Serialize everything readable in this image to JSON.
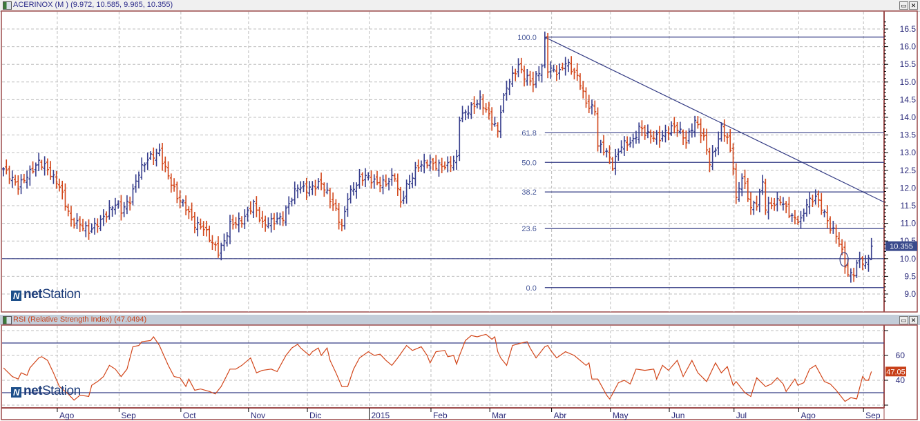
{
  "window": {
    "title": "ACERINOX (M ) (9.972, 10.585, 9.965, 10.355)",
    "maximize_icon": "maximize-icon",
    "close_icon": "close-icon",
    "maximize_glyph": "▭",
    "close_glyph": "✕"
  },
  "rsi_panel": {
    "title": "RSI (Relative Strength Index) (47.0494)"
  },
  "logo": {
    "mark": "N",
    "net": "net",
    "station": "Station"
  },
  "colors": {
    "up": "#363d8c",
    "down": "#d2461a",
    "line": "#343c84",
    "rsi": "#d2461a",
    "axis_text": "#2a2a7a",
    "border": "#9c4a4a",
    "grid": "#bdbdbd"
  },
  "time_axis": {
    "labels": [
      "Ago",
      "Sep",
      "Oct",
      "Nov",
      "Dic",
      "2015",
      "Feb",
      "Mar",
      "Abr",
      "May",
      "Jun",
      "Jul",
      "Ago",
      "Sep"
    ],
    "label_bar_index": [
      19,
      40,
      61,
      84,
      104,
      125,
      146,
      166,
      187,
      207,
      227,
      249,
      271,
      293
    ]
  },
  "chart_data": [
    {
      "type": "ohlc",
      "title": "ACERINOX (M )",
      "last_bar": {
        "open": 9.972,
        "high": 10.585,
        "low": 9.965,
        "close": 10.355
      },
      "last_price_label": "10.355",
      "ylim": [
        8.7,
        16.8
      ],
      "yticks": [
        "16.5",
        "16.0",
        "15.5",
        "15.0",
        "14.5",
        "14.0",
        "13.5",
        "13.0",
        "12.5",
        "12.0",
        "11.5",
        "11.0",
        "10.5",
        "10.0",
        "9.5",
        "9.0"
      ],
      "bar_count": 296,
      "close_path": [
        [
          0,
          12.54
        ],
        [
          5,
          12.05
        ],
        [
          12,
          12.73
        ],
        [
          14,
          12.63
        ],
        [
          19,
          12.05
        ],
        [
          23,
          11.07
        ],
        [
          26,
          10.97
        ],
        [
          29,
          10.78
        ],
        [
          33,
          11.07
        ],
        [
          38,
          11.56
        ],
        [
          40,
          11.36
        ],
        [
          43,
          11.66
        ],
        [
          46,
          12.44
        ],
        [
          49,
          12.83
        ],
        [
          53,
          13.02
        ],
        [
          55,
          12.54
        ],
        [
          59,
          11.75
        ],
        [
          62,
          11.46
        ],
        [
          65,
          10.97
        ],
        [
          68,
          10.88
        ],
        [
          70,
          10.58
        ],
        [
          73,
          10.19
        ],
        [
          75,
          10.48
        ],
        [
          77,
          10.97
        ],
        [
          81,
          11.07
        ],
        [
          85,
          11.56
        ],
        [
          88,
          10.97
        ],
        [
          92,
          11.07
        ],
        [
          95,
          11.17
        ],
        [
          97,
          11.56
        ],
        [
          100,
          12.05
        ],
        [
          103,
          11.95
        ],
        [
          108,
          12.14
        ],
        [
          110,
          11.85
        ],
        [
          113,
          11.36
        ],
        [
          115,
          10.88
        ],
        [
          117,
          11.75
        ],
        [
          121,
          12.24
        ],
        [
          123,
          12.34
        ],
        [
          127,
          12.14
        ],
        [
          130,
          12.14
        ],
        [
          133,
          12.34
        ],
        [
          135,
          11.56
        ],
        [
          137,
          12.05
        ],
        [
          141,
          12.63
        ],
        [
          144,
          12.73
        ],
        [
          147,
          12.63
        ],
        [
          151,
          12.63
        ],
        [
          154,
          12.83
        ],
        [
          155,
          14.0
        ],
        [
          158,
          14.2
        ],
        [
          162,
          14.49
        ],
        [
          164,
          14.2
        ],
        [
          168,
          13.61
        ],
        [
          169,
          14.2
        ],
        [
          171,
          14.88
        ],
        [
          175,
          15.46
        ],
        [
          177,
          15.17
        ],
        [
          180,
          14.98
        ],
        [
          183,
          15.46
        ],
        [
          184,
          16.15
        ],
        [
          185,
          15.37
        ],
        [
          189,
          15.27
        ],
        [
          191,
          15.56
        ],
        [
          194,
          15.27
        ],
        [
          196,
          14.98
        ],
        [
          198,
          14.39
        ],
        [
          201,
          14.2
        ],
        [
          202,
          13.22
        ],
        [
          205,
          13.02
        ],
        [
          207,
          12.63
        ],
        [
          210,
          13.22
        ],
        [
          214,
          13.32
        ],
        [
          216,
          13.71
        ],
        [
          219,
          13.51
        ],
        [
          223,
          13.41
        ],
        [
          227,
          13.71
        ],
        [
          229,
          13.71
        ],
        [
          232,
          13.32
        ],
        [
          235,
          13.9
        ],
        [
          238,
          13.41
        ],
        [
          240,
          12.73
        ],
        [
          242,
          13.12
        ],
        [
          244,
          13.71
        ],
        [
          246,
          13.41
        ],
        [
          248,
          12.63
        ],
        [
          249,
          11.66
        ],
        [
          251,
          12.34
        ],
        [
          254,
          11.46
        ],
        [
          256,
          11.56
        ],
        [
          258,
          12.14
        ],
        [
          259,
          11.46
        ],
        [
          262,
          11.56
        ],
        [
          264,
          11.66
        ],
        [
          268,
          11.17
        ],
        [
          271,
          11.07
        ],
        [
          273,
          11.56
        ],
        [
          276,
          11.75
        ],
        [
          278,
          11.46
        ],
        [
          281,
          10.88
        ],
        [
          283,
          10.68
        ],
        [
          285,
          10.19
        ],
        [
          287,
          9.51
        ],
        [
          289,
          9.61
        ],
        [
          291,
          10.0
        ],
        [
          293,
          9.8
        ],
        [
          295,
          10.355
        ]
      ],
      "support_line": 10.0,
      "fibonacci": {
        "start_bar": 184,
        "high": 16.27,
        "low": 9.18,
        "levels": [
          {
            "pct": 100.0,
            "label": "100.0"
          },
          {
            "pct": 61.8,
            "label": "61.8"
          },
          {
            "pct": 50.0,
            "label": "50.0"
          },
          {
            "pct": 38.2,
            "label": "38.2"
          },
          {
            "pct": 23.6,
            "label": "23.6"
          },
          {
            "pct": 0.0,
            "label": "0.0"
          }
        ]
      },
      "trendline": {
        "from": [
          184,
          16.27
        ],
        "to": [
          300,
          11.6
        ]
      },
      "annotation_ellipse": {
        "bar": 285.7,
        "price": 9.98
      }
    },
    {
      "type": "line",
      "title": "RSI (Relative Strength Index)",
      "last_value": 47.0494,
      "last_value_label": "47.05",
      "ylim": [
        18,
        84
      ],
      "yticks": [
        "60",
        "40"
      ],
      "grid_levels": [
        20,
        40,
        60,
        80
      ],
      "bands": [
        30,
        70
      ],
      "series": [
        [
          0,
          50
        ],
        [
          3,
          43
        ],
        [
          5,
          41
        ],
        [
          6,
          46
        ],
        [
          8,
          44
        ],
        [
          9,
          50
        ],
        [
          12,
          58
        ],
        [
          13,
          59
        ],
        [
          15,
          56
        ],
        [
          17,
          46
        ],
        [
          19,
          35
        ],
        [
          22,
          29
        ],
        [
          24,
          24
        ],
        [
          26,
          28
        ],
        [
          29,
          27
        ],
        [
          30,
          36
        ],
        [
          32,
          39
        ],
        [
          34,
          43
        ],
        [
          36,
          52
        ],
        [
          38,
          49
        ],
        [
          40,
          43
        ],
        [
          42,
          49
        ],
        [
          44,
          67
        ],
        [
          46,
          68
        ],
        [
          47,
          71
        ],
        [
          50,
          72
        ],
        [
          51,
          75
        ],
        [
          53,
          68
        ],
        [
          56,
          52
        ],
        [
          58,
          43
        ],
        [
          60,
          42
        ],
        [
          62,
          35
        ],
        [
          63,
          41
        ],
        [
          65,
          32
        ],
        [
          67,
          33
        ],
        [
          70,
          31
        ],
        [
          72,
          29
        ],
        [
          74,
          35
        ],
        [
          77,
          49
        ],
        [
          79,
          49
        ],
        [
          81,
          52
        ],
        [
          84,
          58
        ],
        [
          86,
          46
        ],
        [
          88,
          48
        ],
        [
          91,
          49
        ],
        [
          93,
          47
        ],
        [
          96,
          60
        ],
        [
          98,
          66
        ],
        [
          100,
          69
        ],
        [
          101,
          66
        ],
        [
          104,
          60
        ],
        [
          105,
          63
        ],
        [
          107,
          66
        ],
        [
          108,
          60
        ],
        [
          110,
          66
        ],
        [
          111,
          56
        ],
        [
          113,
          46
        ],
        [
          115,
          35
        ],
        [
          117,
          35
        ],
        [
          119,
          49
        ],
        [
          121,
          58
        ],
        [
          124,
          63
        ],
        [
          126,
          60
        ],
        [
          128,
          61
        ],
        [
          130,
          56
        ],
        [
          132,
          52
        ],
        [
          134,
          58
        ],
        [
          137,
          68
        ],
        [
          139,
          64
        ],
        [
          142,
          67
        ],
        [
          144,
          60
        ],
        [
          145,
          54
        ],
        [
          147,
          63
        ],
        [
          150,
          64
        ],
        [
          151,
          59
        ],
        [
          153,
          60
        ],
        [
          154,
          53
        ],
        [
          155,
          60
        ],
        [
          157,
          72
        ],
        [
          159,
          76
        ],
        [
          161,
          75
        ],
        [
          164,
          77
        ],
        [
          166,
          73
        ],
        [
          167,
          75
        ],
        [
          168,
          63
        ],
        [
          169,
          58
        ],
        [
          171,
          52
        ],
        [
          173,
          68
        ],
        [
          176,
          70
        ],
        [
          178,
          71
        ],
        [
          179,
          66
        ],
        [
          181,
          58
        ],
        [
          184,
          67
        ],
        [
          185,
          68
        ],
        [
          186,
          64
        ],
        [
          188,
          58
        ],
        [
          191,
          63
        ],
        [
          194,
          60
        ],
        [
          198,
          52
        ],
        [
          199,
          54
        ],
        [
          200,
          41
        ],
        [
          202,
          41
        ],
        [
          205,
          28
        ],
        [
          206,
          25
        ],
        [
          207,
          29
        ],
        [
          209,
          38
        ],
        [
          211,
          40
        ],
        [
          213,
          37
        ],
        [
          215,
          49
        ],
        [
          218,
          48
        ],
        [
          221,
          49
        ],
        [
          222,
          41
        ],
        [
          224,
          52
        ],
        [
          226,
          48
        ],
        [
          229,
          56
        ],
        [
          231,
          43
        ],
        [
          234,
          56
        ],
        [
          236,
          46
        ],
        [
          239,
          39
        ],
        [
          242,
          54
        ],
        [
          244,
          46
        ],
        [
          246,
          51
        ],
        [
          248,
          36
        ],
        [
          249,
          39
        ],
        [
          252,
          30
        ],
        [
          254,
          27
        ],
        [
          256,
          42
        ],
        [
          259,
          35
        ],
        [
          261,
          37
        ],
        [
          263,
          42
        ],
        [
          265,
          37
        ],
        [
          266,
          31
        ],
        [
          269,
          41
        ],
        [
          270,
          36
        ],
        [
          272,
          38
        ],
        [
          274,
          49
        ],
        [
          276,
          52
        ],
        [
          279,
          39
        ],
        [
          281,
          37
        ],
        [
          283,
          32
        ],
        [
          286,
          23
        ],
        [
          288,
          26
        ],
        [
          290,
          25
        ],
        [
          292,
          43
        ],
        [
          293,
          40
        ],
        [
          294,
          40
        ],
        [
          295,
          47.05
        ]
      ]
    }
  ]
}
